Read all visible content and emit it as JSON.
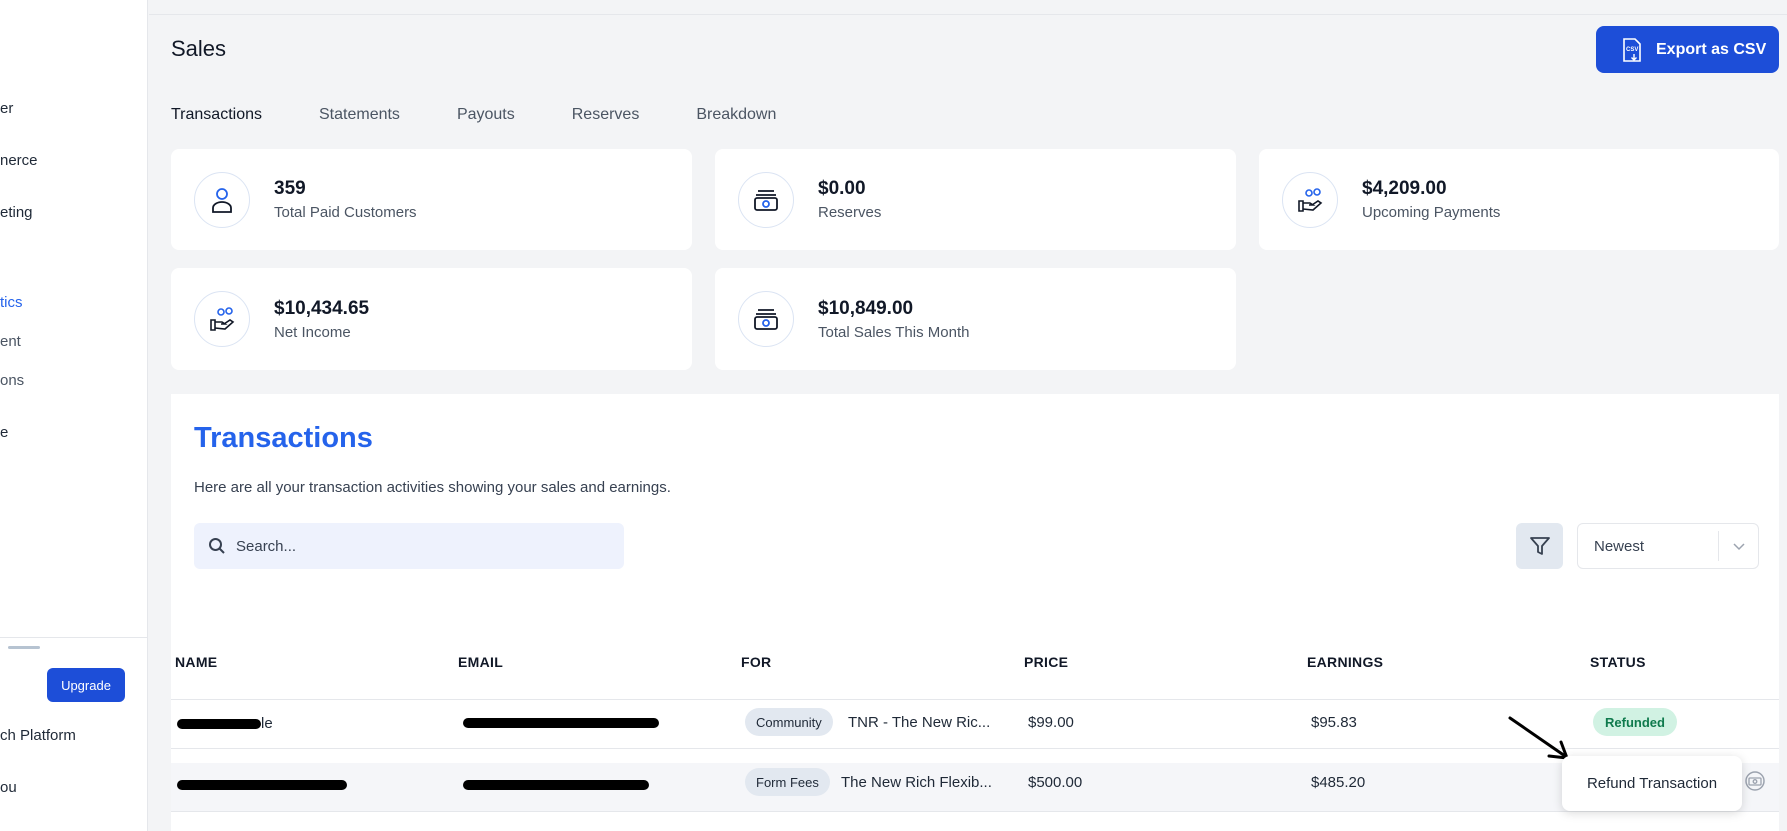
{
  "sidebar": {
    "items": [
      {
        "label": "er"
      },
      {
        "label": "nerce"
      },
      {
        "label": "eting"
      },
      {
        "label": "tics"
      },
      {
        "label": "ent"
      },
      {
        "label": "ons"
      },
      {
        "label": "e"
      }
    ],
    "upgrade_label": "Upgrade",
    "bottom_items": [
      {
        "label": "ch Platform"
      },
      {
        "label": "ou"
      }
    ]
  },
  "header": {
    "title": "Sales",
    "export_label": "Export as CSV",
    "export_icon_text": "CSV"
  },
  "tabs": [
    {
      "label": "Transactions"
    },
    {
      "label": "Statements"
    },
    {
      "label": "Payouts"
    },
    {
      "label": "Reserves"
    },
    {
      "label": "Breakdown"
    }
  ],
  "stats": [
    {
      "value": "359",
      "label": "Total Paid Customers",
      "icon": "user-icon"
    },
    {
      "value": "$0.00",
      "label": "Reserves",
      "icon": "cash-icon"
    },
    {
      "value": "$4,209.00",
      "label": "Upcoming Payments",
      "icon": "hand-coins-icon"
    },
    {
      "value": "$10,434.65",
      "label": "Net Income",
      "icon": "hand-coins-icon"
    },
    {
      "value": "$10,849.00",
      "label": "Total Sales This Month",
      "icon": "cash-icon"
    }
  ],
  "transactions": {
    "title": "Transactions",
    "subtitle": "Here are all your transaction activities showing your sales and earnings.",
    "search_placeholder": "Search...",
    "sort_value": "Newest",
    "columns": [
      "NAME",
      "EMAIL",
      "FOR",
      "PRICE",
      "EARNINGS",
      "STATUS"
    ],
    "rows": [
      {
        "name_suffix": "le",
        "for_tag": "Community",
        "for_title": "TNR - The New Ric...",
        "price": "$99.00",
        "earnings": "$95.83",
        "status": "Refunded"
      },
      {
        "name_suffix": "",
        "for_tag": "Form Fees",
        "for_title": "The New Rich Flexib...",
        "price": "$500.00",
        "earnings": "$485.20",
        "status": ""
      }
    ],
    "popover_label": "Refund Transaction"
  },
  "colors": {
    "accent": "#1d4ed8",
    "link": "#2563eb",
    "status_refunded_bg": "#d1f2e3",
    "status_refunded_text": "#0f7a4d"
  }
}
